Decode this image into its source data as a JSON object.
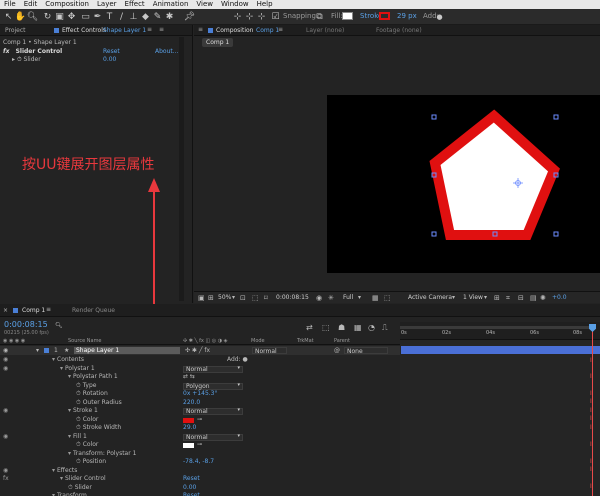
{
  "menu": [
    "File",
    "Edit",
    "Composition",
    "Layer",
    "Effect",
    "Animation",
    "View",
    "Window",
    "Help"
  ],
  "toolbar": {
    "snapping": "Snapping",
    "fill_label": "Fill:",
    "stroke_label": "Stroke:",
    "stroke_width": "29 px",
    "add_label": "Add:"
  },
  "project_tab": "Project",
  "effect_controls_tab": "Effect Controls",
  "effect_controls_layer": "Shape Layer 1",
  "breadcrumb": "Comp 1 • Shape Layer 1",
  "effect": {
    "name": "Slider Control",
    "reset": "Reset",
    "about": "About...",
    "slider_label": "Slider",
    "slider_value": "0.00"
  },
  "comp_tabs": {
    "composition": "Composition",
    "comp_name": "Comp 1",
    "layer": "Layer (none)",
    "footage": "Footage (none)",
    "sub_tab": "Comp 1"
  },
  "annotation": "按UU键展开图层属性",
  "comp_footer": {
    "zoom": "50%",
    "timecode": "0:00:08:15",
    "resolution": "Full",
    "camera": "Active Camera",
    "view": "1 View",
    "exposure": "+0.0"
  },
  "timeline": {
    "tab": "Comp 1",
    "render_queue": "Render Queue",
    "timecode": "0:00:08:15",
    "frame_info": "00215 (25.00 fps)",
    "columns": {
      "source": "Source Name",
      "mode": "Mode",
      "trkmat": "TrkMat",
      "parent": "Parent"
    },
    "ruler": [
      "0s",
      "02s",
      "04s",
      "06s",
      "08s"
    ],
    "layer": {
      "num": "1",
      "name": "Shape Layer 1",
      "mode": "Normal",
      "parent": "None"
    },
    "rows": [
      {
        "label": "Contents",
        "indent": 1,
        "value": "",
        "add": "Add:"
      },
      {
        "label": "Polystar 1",
        "indent": 2,
        "dropdown": "Normal"
      },
      {
        "label": "Polystar Path 1",
        "indent": 3,
        "value": ""
      },
      {
        "label": "Type",
        "indent": 4,
        "dropdown": "Polygon"
      },
      {
        "label": "Rotation",
        "indent": 4,
        "value": "0x +145.3°"
      },
      {
        "label": "Outer Radius",
        "indent": 4,
        "value": "220.0"
      },
      {
        "label": "Stroke 1",
        "indent": 3,
        "dropdown": "Normal"
      },
      {
        "label": "Color",
        "indent": 4,
        "color": "#e01010"
      },
      {
        "label": "Stroke Width",
        "indent": 4,
        "value": "29.0"
      },
      {
        "label": "Fill 1",
        "indent": 3,
        "dropdown": "Normal"
      },
      {
        "label": "Color",
        "indent": 4,
        "color": "#ffffff"
      },
      {
        "label": "Transform: Polystar 1",
        "indent": 3,
        "value": ""
      },
      {
        "label": "Position",
        "indent": 4,
        "value": "-78.4, -8.7"
      },
      {
        "label": "Effects",
        "indent": 1,
        "value": ""
      },
      {
        "label": "Slider Control",
        "indent": 2,
        "value": "Reset"
      },
      {
        "label": "Slider",
        "indent": 3,
        "value": "0.00"
      },
      {
        "label": "Transform",
        "indent": 1,
        "value": "Reset"
      }
    ]
  },
  "colors": {
    "stroke": "#e01010",
    "fill": "#ffffff",
    "accent": "#5aa0e6",
    "layer_bar": "#4a6fd6",
    "annotation": "#e8383d"
  }
}
